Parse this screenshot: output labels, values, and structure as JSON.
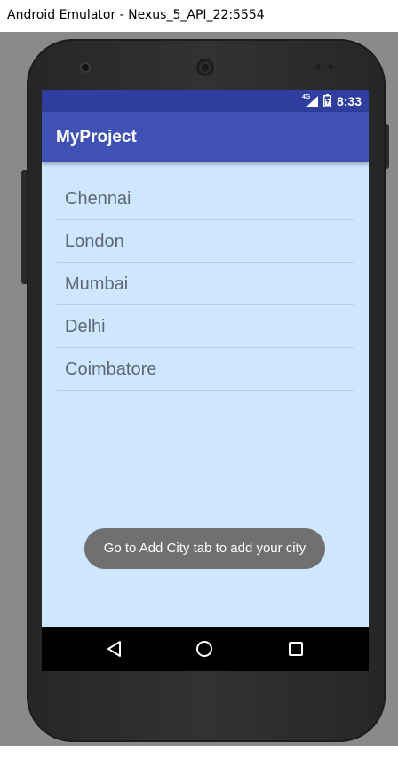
{
  "window": {
    "title": "Android Emulator - Nexus_5_API_22:5554"
  },
  "status_bar": {
    "network_label": "4G",
    "time": "8:33",
    "icons": [
      "signal-icon",
      "battery-icon"
    ]
  },
  "app_bar": {
    "title": "MyProject"
  },
  "cities": [
    {
      "name": "Chennai"
    },
    {
      "name": "London"
    },
    {
      "name": "Mumbai"
    },
    {
      "name": "Delhi"
    },
    {
      "name": "Coimbatore"
    }
  ],
  "toast": {
    "message": "Go to Add City tab to add your city"
  },
  "nav_bar": {
    "icons": [
      "back-icon",
      "home-icon",
      "recents-icon"
    ]
  },
  "colors": {
    "status_bar": "#303f9f",
    "app_bar": "#3f51b5",
    "screen_background": "#cee6fe",
    "toast_background": "#707070",
    "list_text": "#5d6874"
  }
}
